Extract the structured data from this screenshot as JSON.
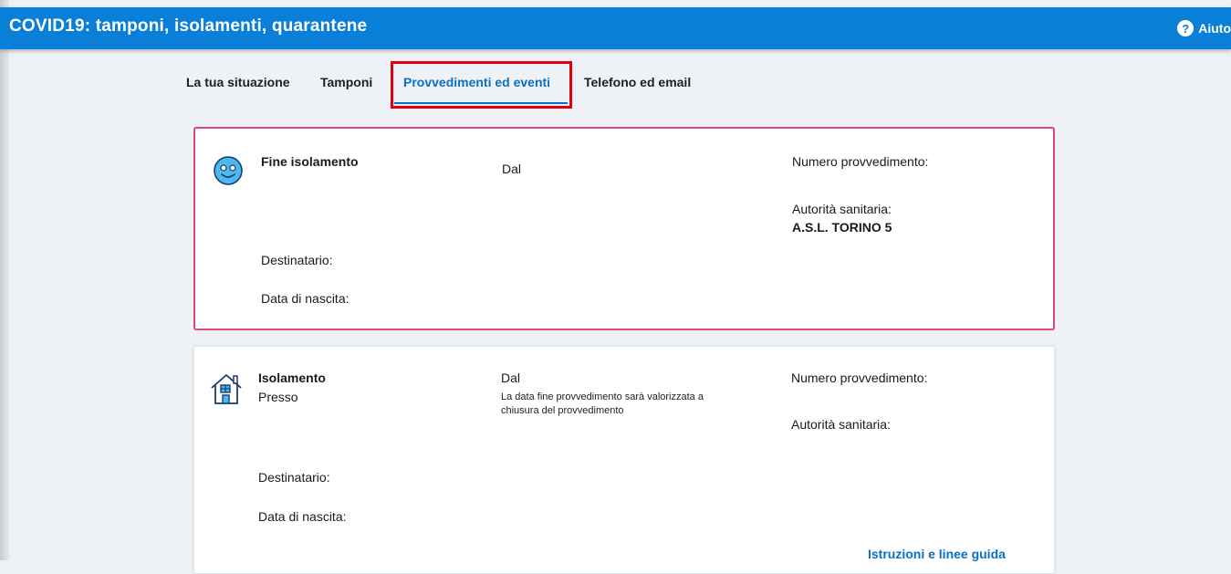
{
  "header": {
    "title": "COVID19: tamponi, isolamenti, quarantene",
    "help_label": "Aiuto"
  },
  "tabs": [
    {
      "label": "La tua situazione"
    },
    {
      "label": "Tamponi"
    },
    {
      "label": "Provvedimenti ed eventi",
      "active": true
    },
    {
      "label": "Telefono ed email"
    }
  ],
  "cards": [
    {
      "icon": "smiley-face-icon",
      "title": "Fine isolamento",
      "from_label": "Dal",
      "number_label": "Numero provvedimento:",
      "authority_label": "Autorità sanitaria:",
      "authority_value": "A.S.L. TORINO 5",
      "recipient_label": "Destinatario:",
      "birth_label": "Data di nascita:"
    },
    {
      "icon": "house-icon",
      "title": "Isolamento",
      "location_label": "Presso",
      "from_label": "Dal",
      "note": "La data fine provvedimento sarà valorizzata a chiusura del provvedimento",
      "note_line1": "La data fine provvedimento sarà valorizzata a",
      "note_line2": "chiusura del provvedimento",
      "number_label": "Numero provvedimento:",
      "authority_label": "Autorità sanitaria:",
      "recipient_label": "Destinatario:",
      "birth_label": "Data di nascita:",
      "link_label": "Istruzioni e linee guida"
    }
  ],
  "colors": {
    "header": "#0a7fd8",
    "accent": "#0a6fc2",
    "highlight": "#e3000b",
    "card_border": "#e0457b",
    "icon_face": "#4db8f0"
  }
}
